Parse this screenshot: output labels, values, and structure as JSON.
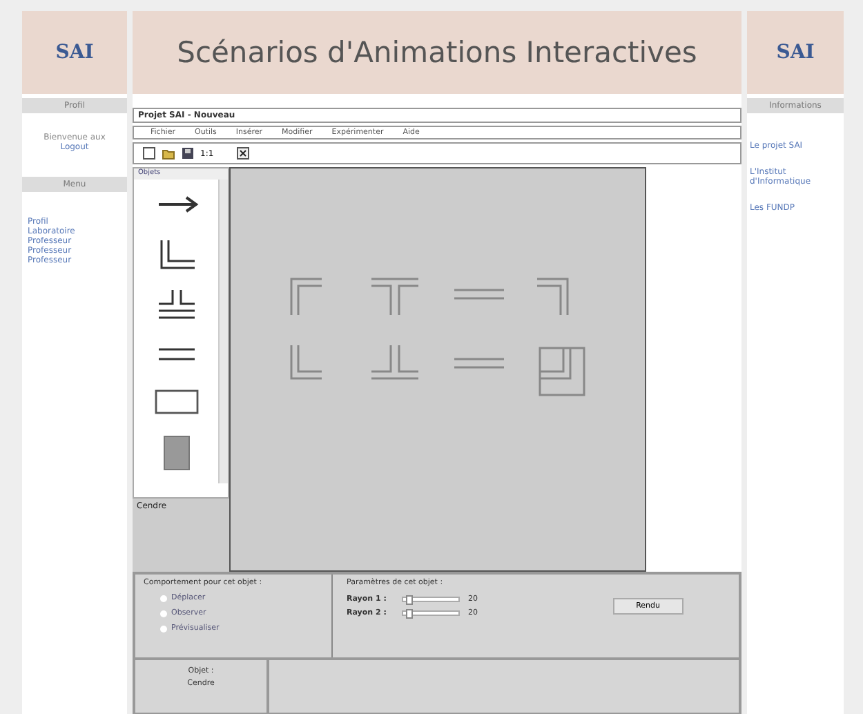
{
  "header": {
    "logo_left": "SAI",
    "title": "Scénarios d'Animations Interactives",
    "logo_right": "SAI"
  },
  "left": {
    "profile_heading": "Profil",
    "welcome": "Bienvenue aux",
    "logout": "Logout",
    "menu_heading": "Menu",
    "menu": [
      "Profil",
      "Laboratoire",
      "Professeur",
      "Professeur",
      "Professeur"
    ]
  },
  "right": {
    "heading": "Informations",
    "links": [
      "Le projet SAI",
      "L'Institut d'Informatique",
      "Les FUNDP"
    ]
  },
  "app": {
    "title": "Projet SAI - Nouveau",
    "menus": [
      "Fichier",
      "Outils",
      "Insérer",
      "Modifier",
      "Expérimenter",
      "Aide"
    ],
    "zoom": "1:1",
    "palette_tab": "Objets",
    "palette_label": "Cendre",
    "palette_items": [
      {
        "kind": "arrow"
      },
      {
        "kind": "corner"
      },
      {
        "kind": "tee"
      },
      {
        "kind": "double"
      },
      {
        "kind": "rect"
      },
      {
        "kind": "block"
      }
    ],
    "canvas_shapes": [
      {
        "kind": "corner_tl"
      },
      {
        "kind": "tee_top"
      },
      {
        "kind": "double"
      },
      {
        "kind": "corner_tr"
      },
      {
        "kind": "corner_bl"
      },
      {
        "kind": "tee_bottom"
      },
      {
        "kind": "double"
      },
      {
        "kind": "box"
      }
    ],
    "behaviour": {
      "heading": "Comportement pour cet objet :",
      "options": [
        {
          "label": "Déplacer",
          "selected": false
        },
        {
          "label": "Observer",
          "selected": false
        },
        {
          "label": "Prévisualiser",
          "selected": false
        }
      ]
    },
    "params": {
      "heading": "Paramètres de cet objet :",
      "sliders": [
        {
          "label": "Rayon 1 :",
          "level": 0.1,
          "reading": "20"
        },
        {
          "label": "Rayon 2 :",
          "level": 0.1,
          "reading": "20"
        }
      ],
      "button": "Rendu"
    },
    "object": {
      "heading": "Objet :",
      "name": "Cendre"
    }
  }
}
